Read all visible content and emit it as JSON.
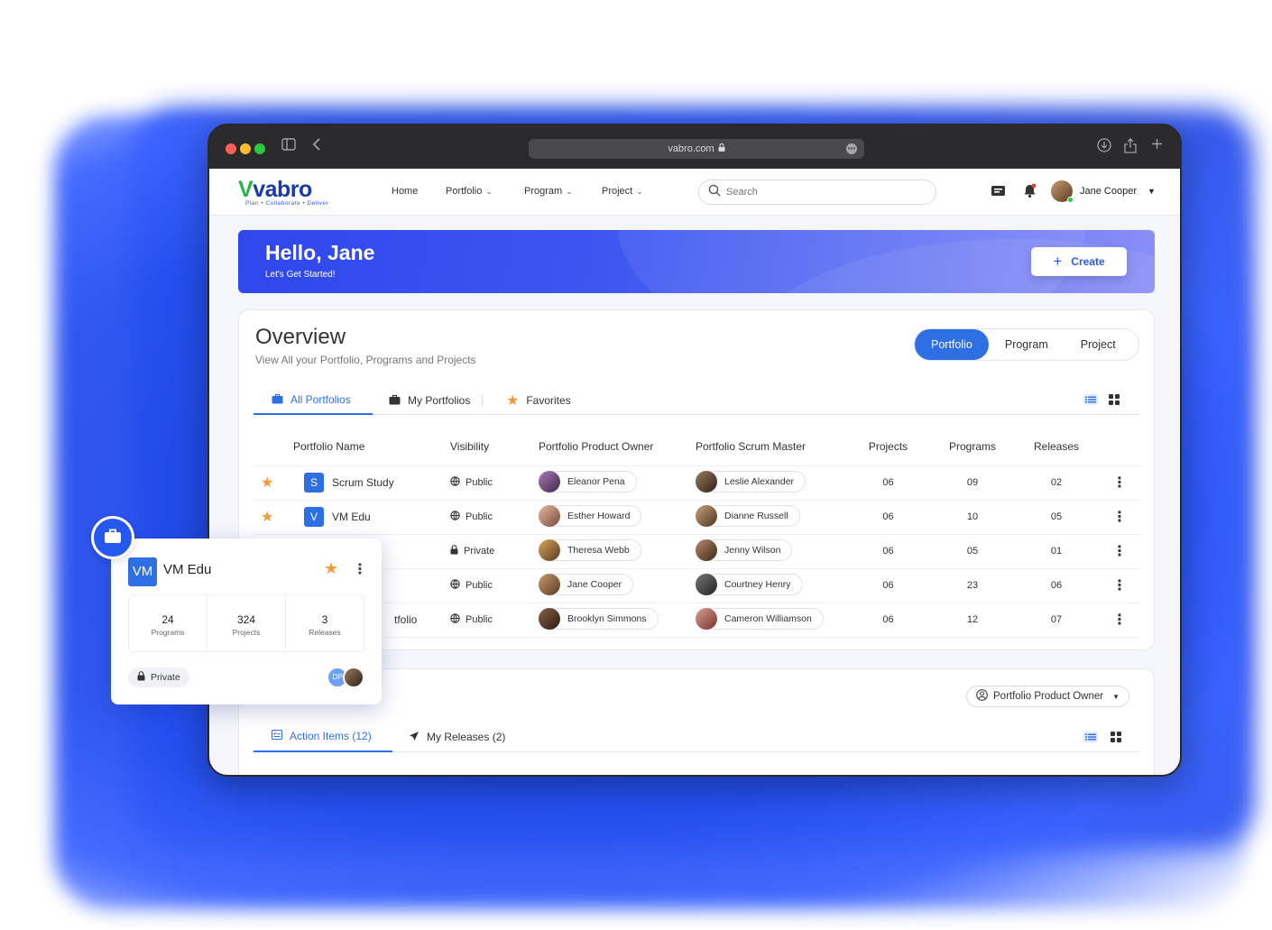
{
  "browser": {
    "url": "vabro.com"
  },
  "app": {
    "logo": {
      "name_prefix": "V",
      "name": "vabro",
      "tagline": "Plan • Collaborate • Deliver"
    },
    "nav": {
      "home": "Home",
      "portfolio": "Portfolio",
      "program": "Program",
      "project": "Project"
    },
    "search_placeholder": "Search",
    "user": {
      "name": "Jane Cooper"
    }
  },
  "hero": {
    "greeting": "Hello, Jane",
    "subtitle": "Let's Get Started!",
    "create_label": "Create"
  },
  "overview": {
    "title": "Overview",
    "subtitle": "View All your Portfolio, Programs and Projects",
    "segments": [
      "Portfolio",
      "Program",
      "Project"
    ],
    "active_segment": "Portfolio",
    "tabs": {
      "all": "All Portfolios",
      "mine": "My Portfolios",
      "fav": "Favorites"
    },
    "columns": {
      "name": "Portfolio Name",
      "visibility": "Visibility",
      "owner": "Portfolio Product Owner",
      "scrum": "Portfolio Scrum Master",
      "projects": "Projects",
      "programs": "Programs",
      "releases": "Releases"
    },
    "rows": [
      {
        "starred": true,
        "initial": "S",
        "name": "Scrum Study",
        "visibility": "Public",
        "owner": "Eleanor Pena",
        "scrum": "Leslie Alexander",
        "projects": "06",
        "programs": "09",
        "releases": "02"
      },
      {
        "starred": true,
        "initial": "V",
        "name": "VM Edu",
        "visibility": "Public",
        "owner": "Esther Howard",
        "scrum": "Dianne Russell",
        "projects": "06",
        "programs": "10",
        "releases": "05"
      },
      {
        "starred": false,
        "initial": "",
        "name": "",
        "visibility": "Private",
        "owner": "Theresa Webb",
        "scrum": "Jenny Wilson",
        "projects": "06",
        "programs": "05",
        "releases": "01"
      },
      {
        "starred": false,
        "initial": "",
        "name": "",
        "visibility": "Public",
        "owner": "Jane Cooper",
        "scrum": "Courtney Henry",
        "projects": "06",
        "programs": "23",
        "releases": "06"
      },
      {
        "starred": false,
        "initial": "",
        "name": "tfolio",
        "visibility": "Public",
        "owner": "Brooklyn Simmons",
        "scrum": "Cameron Williamson",
        "projects": "06",
        "programs": "12",
        "releases": "07"
      }
    ]
  },
  "section2": {
    "owner_filter": "Portfolio Product Owner",
    "tabs": {
      "actions": "Action Items (12)",
      "releases": "My Releases (2)"
    }
  },
  "float_card": {
    "badge": "VM",
    "name": "VM Edu",
    "stats": [
      {
        "value": "24",
        "label": "Programs"
      },
      {
        "value": "324",
        "label": "Projects"
      },
      {
        "value": "3",
        "label": "Releases"
      }
    ],
    "visibility": "Private",
    "avatar_initials": "DP"
  },
  "colors": {
    "primary": "#2f6fe4",
    "star": "#f49a38",
    "hero_start": "#2f47ec",
    "glow": "#2148e8"
  }
}
